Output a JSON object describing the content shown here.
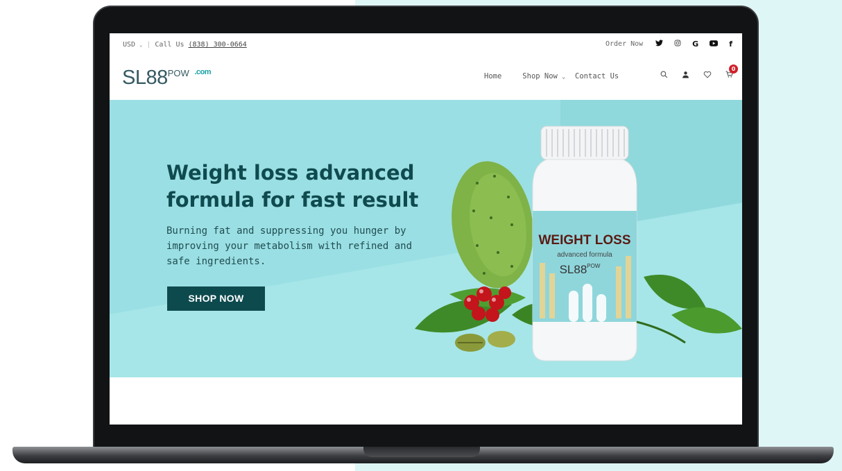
{
  "topbar": {
    "currency": "USD",
    "call_label": "Call Us",
    "phone": "(838) 300-0664",
    "order_now": "Order Now",
    "social_icons": [
      "twitter-icon",
      "instagram-icon",
      "google-icon",
      "youtube-icon",
      "facebook-icon"
    ]
  },
  "header": {
    "logo_main": "SL88",
    "logo_sup": "POW",
    "logo_domain": ".com",
    "nav": {
      "home": "Home",
      "shop_now": "Shop Now",
      "contact_us": "Contact Us"
    },
    "cart_count": "0"
  },
  "hero": {
    "title": "Weight loss advanced formula for fast result",
    "subtitle": "Burning fat and suppressing you hunger by improving your metabolism with refined and safe ingredients.",
    "button": "SHOP NOW",
    "product_label": {
      "line1": "WEIGHT LOSS",
      "line2": "advanced formula",
      "brand": "SL88",
      "brand_sup": "POW"
    }
  },
  "colors": {
    "hero_bg": "#9adfe3",
    "title": "#0f4a4f",
    "button_bg": "#0d4a4e",
    "cart_badge": "#d0202a",
    "logo_accent": "#17a0a8"
  }
}
